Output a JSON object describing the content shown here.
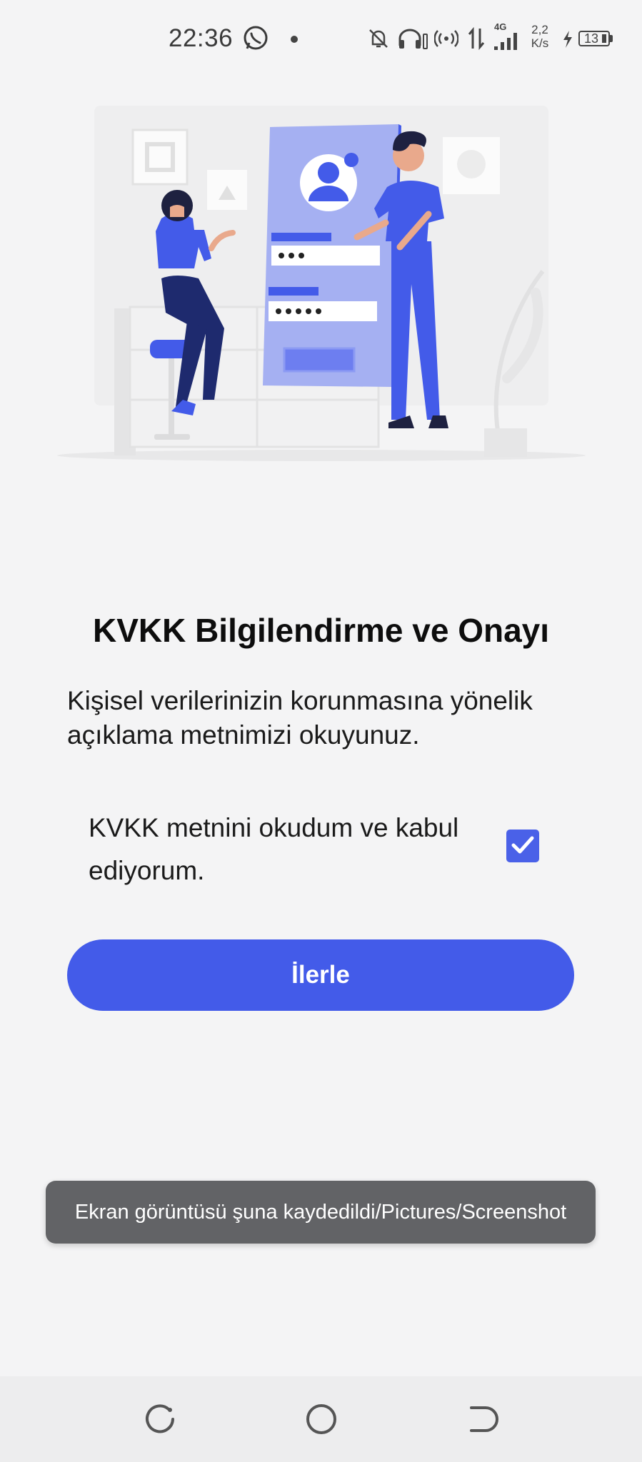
{
  "status_bar": {
    "time": "22:36",
    "network": "4G",
    "speed_value": "2,2",
    "speed_unit": "K/s",
    "battery": "13",
    "icons": [
      "whatsapp-icon",
      "dot-icon",
      "bell-off-icon",
      "headphones-icon",
      "hotspot-icon",
      "data-arrows-icon",
      "signal-icon",
      "charging-icon",
      "battery-icon"
    ]
  },
  "content": {
    "title": "KVKK Bilgilendirme ve Onayı",
    "description": "Kişisel verilerinizin korunmasına yönelik açıklama metnimizi okuyunuz.",
    "consent_label": "KVKK metnini okudum ve kabul ediyorum.",
    "consent_checked": true,
    "next_button": "İlerle"
  },
  "toast": {
    "message": "Ekran görüntüsü şuna kaydedildi/Pictures/Screenshot"
  },
  "nav_bar": {
    "items": [
      "recents-icon",
      "home-icon",
      "back-icon"
    ]
  },
  "colors": {
    "accent": "#435be9",
    "background": "#f4f4f5",
    "toast": "#626366"
  }
}
